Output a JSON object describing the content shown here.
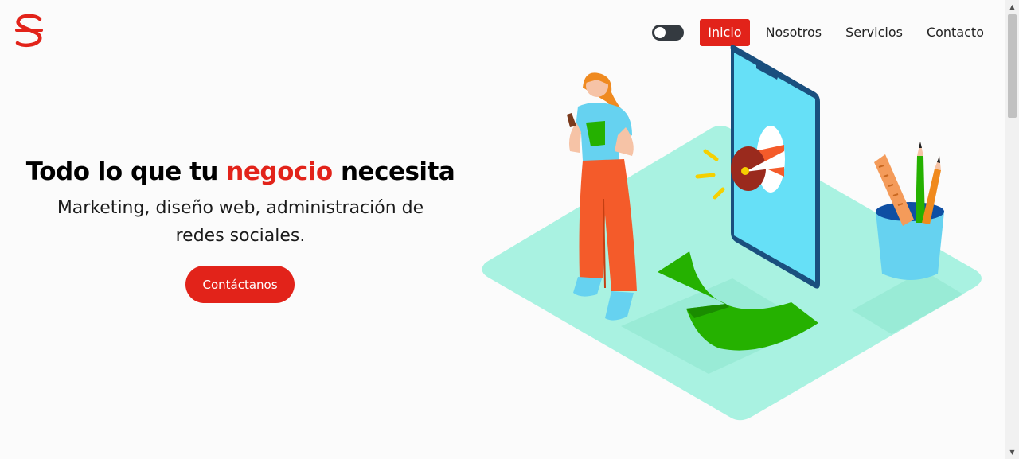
{
  "brand": {
    "logo_icon": "s-logo-icon",
    "accent_color": "#e2231a"
  },
  "nav": {
    "theme_toggle_icon": "theme-toggle-icon",
    "items": [
      {
        "label": "Inicio",
        "active": true
      },
      {
        "label": "Nosotros",
        "active": false
      },
      {
        "label": "Servicios",
        "active": false
      },
      {
        "label": "Contacto",
        "active": false
      }
    ]
  },
  "hero": {
    "title_before": "Todo lo que tu ",
    "title_accent": "negocio",
    "title_after": " necesita",
    "subtitle": "Marketing, diseño web, administración de redes sociales.",
    "cta_label": "Contáctanos"
  },
  "illustration": {
    "icon": "marketing-illustration-icon"
  }
}
